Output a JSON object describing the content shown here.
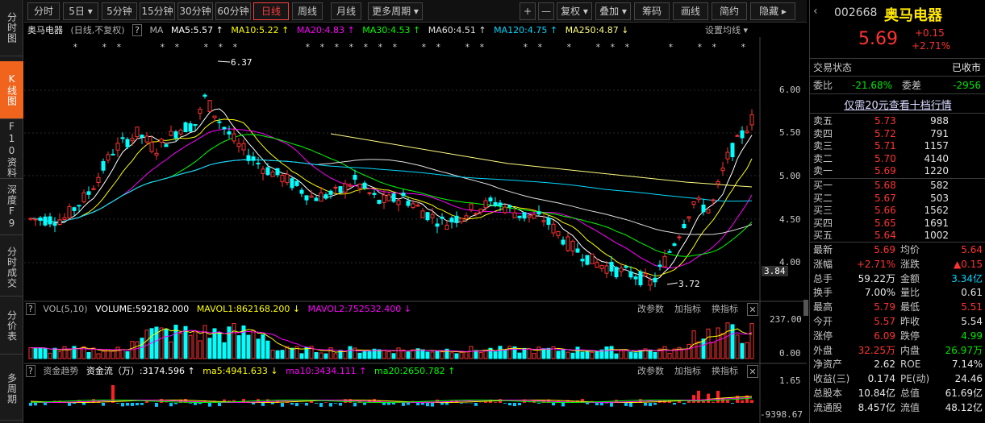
{
  "sidebar": {
    "tabs": [
      {
        "label": "分时图",
        "active": false
      },
      {
        "label": "K线图",
        "active": true
      },
      {
        "label": "F10资料",
        "active": false
      },
      {
        "label": "深度F9",
        "active": false
      },
      {
        "label": "分时成交",
        "active": false
      },
      {
        "label": "分价表",
        "active": false
      },
      {
        "label": "多周期",
        "active": false
      }
    ]
  },
  "toolbar": {
    "periods": [
      "分时",
      "5日 ▾",
      "5分钟",
      "15分钟",
      "30分钟",
      "60分钟",
      "日线",
      "周线",
      "月线",
      "更多周期 ▾"
    ],
    "active_period": "日线",
    "tools": [
      "+",
      "—",
      "复权 ▾",
      "叠加 ▾",
      "筹码",
      "画线",
      "简约",
      "隐藏 ▸"
    ]
  },
  "main_chart": {
    "header": {
      "name": "奥马电器",
      "mode": "(日线,不复权)",
      "help": "?",
      "ma_label": "MA",
      "ma5": "MA5:5.57 ↑",
      "ma10": "MA10:5.22 ↑",
      "ma20": "MA20:4.83 ↑",
      "ma30": "MA30:4.53 ↑",
      "ma60": "MA60:4.51 ↑",
      "ma120": "MA120:4.75 ↑",
      "ma250": "MA250:4.87 ↓",
      "settings": "设置均线 ▾"
    },
    "high_label": "6.37",
    "low_label": "3.72",
    "y_ticks": [
      "6.00",
      "5.50",
      "5.00",
      "4.50",
      "4.00"
    ],
    "cursor_price": "3.84",
    "colors": {
      "ma5": "#ffffff",
      "ma10": "#ffff00",
      "ma20": "#ff00ff",
      "ma30": "#00ff00",
      "ma60": "#e0e0e0",
      "ma120": "#00d8ff",
      "ma250": "#ffff80",
      "up": "#ff3232",
      "down": "#00ffff"
    }
  },
  "volume_chart": {
    "header": {
      "close": "✕",
      "help": "?",
      "label": "VOL(5,10)",
      "volume": "VOLUME:592182.000",
      "mavol1": "MAVOL1:862168.200 ↓",
      "mavol2": "MAVOL2:752532.400 ↓",
      "btn_params": "改参数",
      "btn_add": "加指标",
      "btn_swap": "换指标"
    },
    "y_ticks": [
      "237.00",
      "0.00"
    ]
  },
  "flow_chart": {
    "header": {
      "close": "✕",
      "help": "?",
      "label": "资金趋势",
      "flow": "资金流（万）:3174.596 ↑",
      "ma5": "ma5:4941.633 ↓",
      "ma10": "ma10:3434.111 ↑",
      "ma20": "ma20:2650.782 ↑",
      "btn_params": "改参数",
      "btn_add": "加指标",
      "btn_swap": "换指标"
    },
    "y_ticks": [
      "1.65",
      "-9398.67"
    ]
  },
  "quote": {
    "code": "002668",
    "name": "奥马电器",
    "price": "5.69",
    "change": "+0.15",
    "change_pct": "+2.71%",
    "status_label": "交易状态",
    "status_value": "已收市",
    "weibi_label": "委比",
    "weibi_value": "-21.68%",
    "weicha_label": "委差",
    "weicha_value": "-2956",
    "link": "仅需20元查看十档行情",
    "asks": [
      {
        "label": "卖五",
        "price": "5.73",
        "vol": "988"
      },
      {
        "label": "卖四",
        "price": "5.72",
        "vol": "791"
      },
      {
        "label": "卖三",
        "price": "5.71",
        "vol": "1157"
      },
      {
        "label": "卖二",
        "price": "5.70",
        "vol": "4140"
      },
      {
        "label": "卖一",
        "price": "5.69",
        "vol": "1220"
      }
    ],
    "bids": [
      {
        "label": "买一",
        "price": "5.68",
        "vol": "582"
      },
      {
        "label": "买二",
        "price": "5.67",
        "vol": "503"
      },
      {
        "label": "买三",
        "price": "5.66",
        "vol": "1562"
      },
      {
        "label": "买四",
        "price": "5.65",
        "vol": "1691"
      },
      {
        "label": "买五",
        "price": "5.64",
        "vol": "1002"
      }
    ],
    "stats": [
      {
        "l1": "最新",
        "v1": "5.69",
        "c1": "red",
        "l2": "均价",
        "v2": "5.64",
        "c2": "red"
      },
      {
        "l1": "涨幅",
        "v1": "+2.71%",
        "c1": "red",
        "l2": "涨跌",
        "v2": "▲0.15",
        "c2": "red"
      },
      {
        "l1": "总手",
        "v1": "59.22万",
        "c1": "white",
        "l2": "金额",
        "v2": "3.34亿",
        "c2": "cyan"
      },
      {
        "l1": "换手",
        "v1": "7.00%",
        "c1": "white",
        "l2": "量比",
        "v2": "0.61",
        "c2": "white"
      },
      {
        "l1": "最高",
        "v1": "5.79",
        "c1": "red",
        "l2": "最低",
        "v2": "5.51",
        "c2": "red"
      },
      {
        "l1": "今开",
        "v1": "5.57",
        "c1": "red",
        "l2": "昨收",
        "v2": "5.54",
        "c2": "white"
      },
      {
        "l1": "涨停",
        "v1": "6.09",
        "c1": "red",
        "l2": "跌停",
        "v2": "4.99",
        "c2": "green"
      },
      {
        "l1": "外盘",
        "v1": "32.25万",
        "c1": "red",
        "l2": "内盘",
        "v2": "26.97万",
        "c2": "green"
      },
      {
        "l1": "净资产",
        "v1": "2.62",
        "c1": "white",
        "l2": "ROE",
        "v2": "7.14%",
        "c2": "white"
      },
      {
        "l1": "收益(三)",
        "v1": "0.174",
        "c1": "white",
        "l2": "PE(动)",
        "v2": "24.46",
        "c2": "white"
      },
      {
        "l1": "总股本",
        "v1": "10.84亿",
        "c1": "white",
        "l2": "总值",
        "v2": "61.69亿",
        "c2": "white"
      },
      {
        "l1": "流通股",
        "v1": "8.457亿",
        "c1": "white",
        "l2": "流值",
        "v2": "48.12亿",
        "c2": "white"
      }
    ]
  }
}
